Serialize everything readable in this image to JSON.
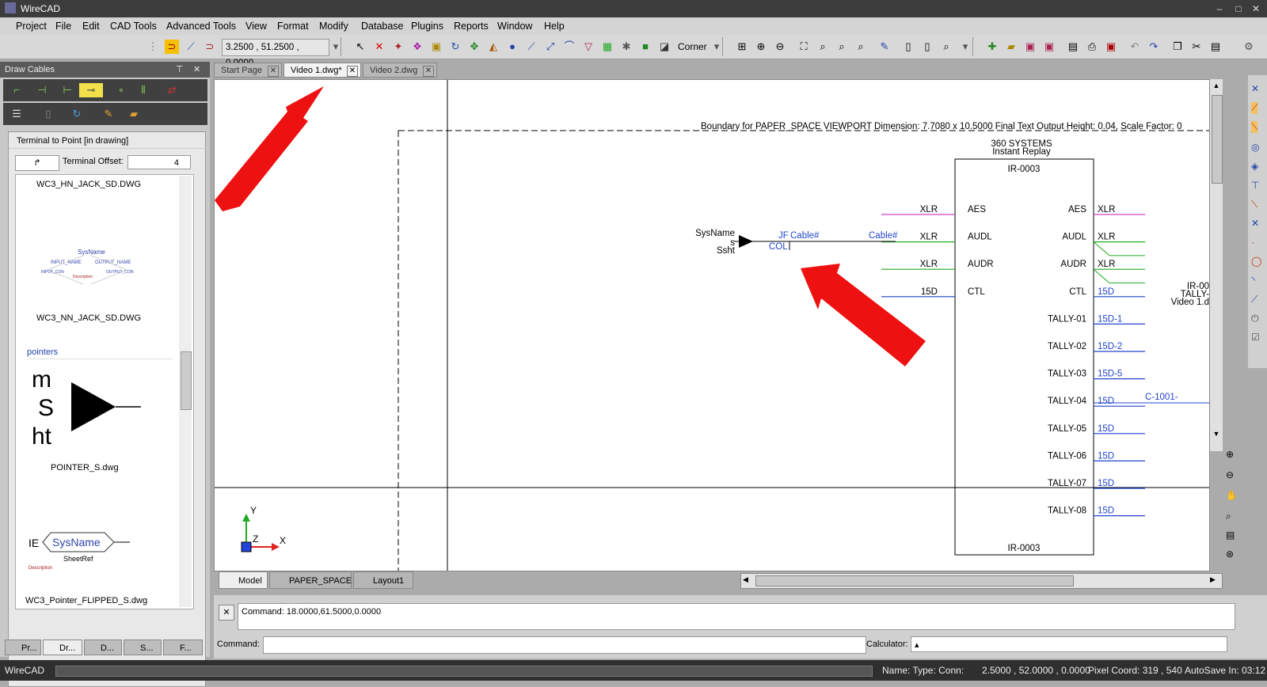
{
  "app": {
    "title": "WireCAD"
  },
  "menu": [
    "Project",
    "File",
    "Edit",
    "CAD Tools",
    "Advanced Tools",
    "View",
    "Format",
    "Modify",
    "Database",
    "Plugins",
    "Reports",
    "Window",
    "Help"
  ],
  "toolbar": {
    "coords": "3.2500 , 51.2500 , 0.0000",
    "snap_mode": "Corner"
  },
  "left_panel": {
    "title": "Draw Cables",
    "mode_title": "Terminal to Point [in drawing]",
    "terminal_offset_label": "Terminal Offset:",
    "terminal_offset_value": "4",
    "items": [
      "WC3_HN_JACK_SD.DWG",
      "WC3_NN_JACK_SD.DWG",
      "POINTER_S.dwg",
      "WC3_Pointer_FLIPPED_S.dwg"
    ],
    "section_label": "pointers",
    "bottom_tabs": [
      "Pr...",
      "Dr...",
      "D...",
      "S...",
      "F..."
    ]
  },
  "tabs": [
    {
      "label": "Start Page",
      "active": false
    },
    {
      "label": "Video 1.dwg*",
      "active": true
    },
    {
      "label": "Video 2.dwg",
      "active": false
    }
  ],
  "layout_tabs": [
    "Model",
    "PAPER_SPACE",
    "Layout1"
  ],
  "command": {
    "history": "Command: 18.0000,61.5000,0.0000",
    "label": "Command:",
    "calc_label": "Calculator:"
  },
  "drawing": {
    "boundary_text": "Boundary for PAPER_SPACE VIEWPORT Dimension: 7.7080 x 10.5000 Final Text Output Height: 0.04, Scale Factor: 0",
    "device_header1": "360 SYSTEMS",
    "device_header2": "Instant Replay",
    "device_id": "IR-0003",
    "left_connectors": [
      {
        "type": "XLR",
        "port": "AES",
        "color": "#cc44cc"
      },
      {
        "type": "XLR",
        "port": "AUDL",
        "color": "#22aa22"
      },
      {
        "type": "XLR",
        "port": "AUDR",
        "color": "#22aa22"
      },
      {
        "type": "15D",
        "port": "CTL",
        "color": "#2244cc"
      }
    ],
    "right_ports": [
      {
        "port": "AES",
        "type": "XLR",
        "color": "#cc44cc"
      },
      {
        "port": "AUDL",
        "type": "XLR",
        "color": "#22aa22"
      },
      {
        "port": "AUDR",
        "type": "XLR",
        "color": "#22aa22"
      },
      {
        "port": "CTL",
        "type": "15D",
        "color": "#2244cc"
      },
      {
        "port": "TALLY-01",
        "type": "15D-1",
        "color": "#2244cc"
      },
      {
        "port": "TALLY-02",
        "type": "15D-2",
        "color": "#2244cc"
      },
      {
        "port": "TALLY-03",
        "type": "15D-5",
        "color": "#2244cc"
      },
      {
        "port": "TALLY-04",
        "type": "15D",
        "color": "#2244cc"
      },
      {
        "port": "TALLY-05",
        "type": "15D",
        "color": "#2244cc"
      },
      {
        "port": "TALLY-06",
        "type": "15D",
        "color": "#2244cc"
      },
      {
        "port": "TALLY-07",
        "type": "15D",
        "color": "#2244cc"
      },
      {
        "port": "TALLY-08",
        "type": "15D",
        "color": "#2244cc"
      }
    ],
    "cable_label_c": "C-1001-",
    "pointer": {
      "sysname": "SysName",
      "s": "s",
      "ssht": "Ssht",
      "jf": "JF",
      "col": "COL",
      "cable1": "Cable#",
      "cable2": "Cable#"
    },
    "offscreen": [
      "IR-00",
      "TALLY-",
      "Video 1.d"
    ],
    "axes": {
      "y": "Y",
      "x": "X",
      "z": "Z"
    }
  },
  "status": {
    "app": "WireCAD",
    "name_type_conn": "Name: Type: Conn:",
    "coords": "2.5000 , 52.0000 , 0.0000",
    "pixel_coord": "Pixel Coord: 319 , 540",
    "autosave": "AutoSave In: 03:12"
  },
  "colors": {
    "annotation_arrow": "#ee1111",
    "xlr_pink": "#cc44cc",
    "audio_green": "#22aa22",
    "control_blue": "#2244cc"
  }
}
